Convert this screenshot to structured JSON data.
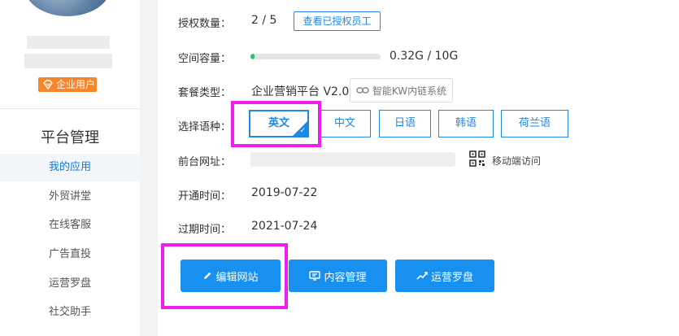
{
  "sidebar": {
    "user_tag": "企业用户",
    "section_title": "平台管理",
    "items": [
      {
        "label": "我的应用",
        "active": true
      },
      {
        "label": "外贸讲堂",
        "active": false
      },
      {
        "label": "在线客服",
        "active": false
      },
      {
        "label": "广告直投",
        "active": false
      },
      {
        "label": "运营罗盘",
        "active": false
      },
      {
        "label": "社交助手",
        "active": false
      }
    ]
  },
  "info": {
    "license_label": "授权数量：",
    "license_value": "2 / 5",
    "view_staff_button": "查看已授权员工",
    "storage_label": "空间容量：",
    "storage_used_fraction": 0.032,
    "storage_value": "0.32G / 10G",
    "plan_label": "套餐类型：",
    "plan_value": "企业营销平台 V2.0",
    "kw_button": "智能KW内链系统",
    "language_label": "选择语种：",
    "languages": [
      "英文",
      "中文",
      "日语",
      "韩语",
      "荷兰语"
    ],
    "selected_language": "英文",
    "site_url_label": "前台网址：",
    "mobile_visit": "移动端访问",
    "open_time_label": "开通时间：",
    "open_time": "2019-07-22",
    "expire_time_label": "过期时间：",
    "expire_time": "2021-07-24"
  },
  "actions": {
    "edit_site": "编辑网站",
    "content_manage": "内容管理",
    "operation_compass": "运营罗盘"
  },
  "colors": {
    "primary": "#1890f0",
    "accent_orange": "#f5862a",
    "progress_green": "#2fbf71",
    "highlight": "#ef1eef"
  }
}
